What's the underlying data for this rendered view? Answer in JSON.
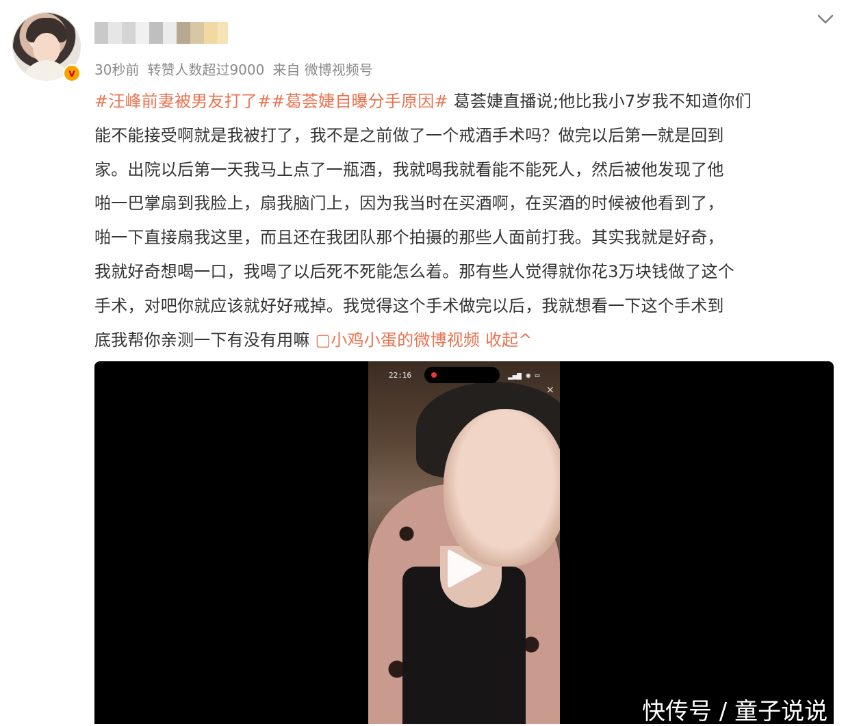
{
  "post": {
    "timestamp": "30秒前",
    "repost_note": "转赞人数超过9000",
    "source": "来自 微博视频号",
    "text_lines": [
      [
        {
          "t": "#汪峰前妻被男友打了#",
          "k": "tag"
        },
        {
          "t": "#葛荟婕自曝分手原因#",
          "k": "tag"
        },
        {
          "t": " 葛荟婕直播说;他比我小7岁我不知道你们",
          "k": "text"
        }
      ],
      [
        {
          "t": "能不能接受啊就是我被打了，我不是之前做了一个戒酒手术吗？做完以后第一就是回到",
          "k": "text"
        }
      ],
      [
        {
          "t": "家。出院以后第一天我马上点了一瓶酒，我就喝我就看能不能死人，然后被他发现了他",
          "k": "text"
        }
      ],
      [
        {
          "t": "啪一巴掌扇到我脸上，扇我脑门上，因为我当时在买酒啊，在买酒的时候被他看到了，",
          "k": "text"
        }
      ],
      [
        {
          "t": "啪一下直接扇我这里，而且还在我团队那个拍摄的那些人面前打我。其实我就是好奇，",
          "k": "text"
        }
      ],
      [
        {
          "t": "我就好奇想喝一口，我喝了以后死不死能怎么着。那有些人觉得就你花3万块钱做了这个",
          "k": "text"
        }
      ],
      [
        {
          "t": "手术，对吧你就应该就好好戒掉。我觉得这个手术做完以后，我就想看一下这个手术到",
          "k": "text"
        }
      ],
      [
        {
          "t": "底我帮你亲测一下有没有用嘛 ",
          "k": "text"
        },
        {
          "t": "▢小鸡小蛋的微博视频",
          "k": "link"
        },
        {
          "t": " 收起^",
          "k": "link"
        }
      ]
    ]
  },
  "video": {
    "phone_time": "22:16",
    "close_symbol": "×"
  },
  "watermark": "快传号 / 童子说说",
  "colors": {
    "accent": "#eb7350",
    "meta": "#8a8a8a",
    "text": "#333333",
    "verified_badge": "#f7a400"
  },
  "icons": [
    "chevron-down-icon",
    "verified-badge-icon",
    "play-icon",
    "close-icon"
  ]
}
